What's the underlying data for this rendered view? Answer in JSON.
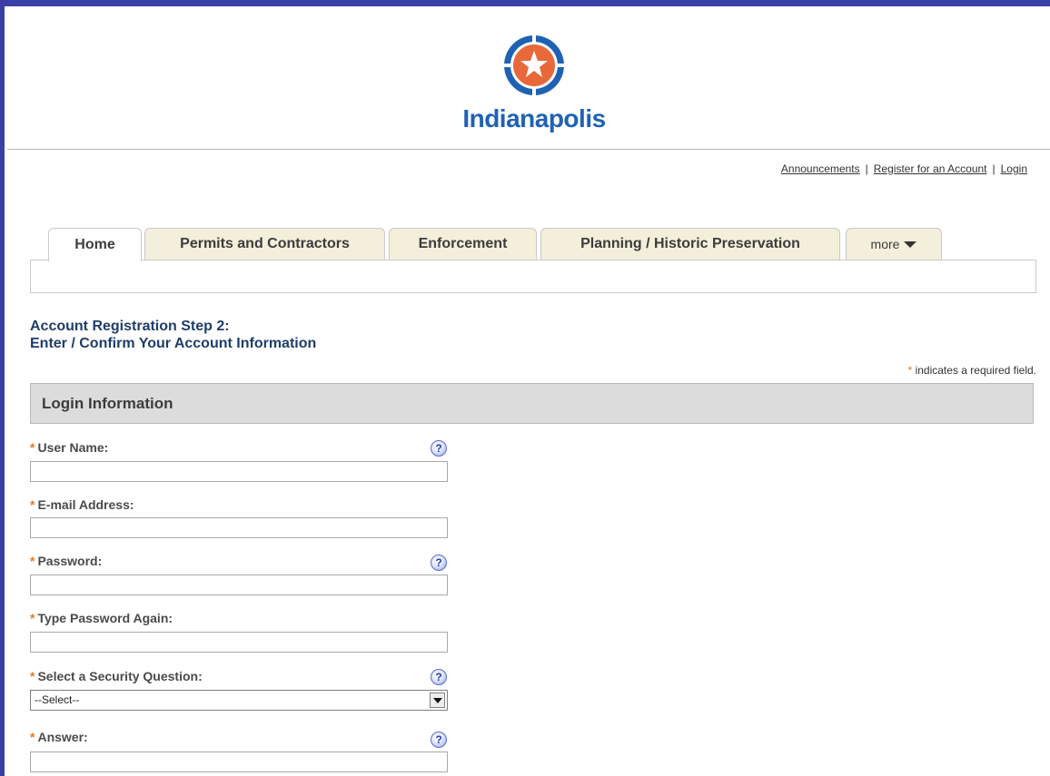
{
  "header": {
    "logo_text": "Indianapolis",
    "brand_color": "#1f62b4",
    "logo_color": "#e8683a"
  },
  "toplinks": {
    "announcements": "Announcements",
    "register": "Register for an Account",
    "login": "Login",
    "separator": "|"
  },
  "tabs": [
    {
      "label": "Home"
    },
    {
      "label": "Permits and Contractors"
    },
    {
      "label": "Enforcement"
    },
    {
      "label": "Planning / Historic Preservation"
    },
    {
      "label": "more"
    }
  ],
  "page": {
    "title_line1": "Account Registration Step 2:",
    "title_line2": "Enter / Confirm Your Account Information",
    "required_star": "*",
    "required_note": "indicates a required field."
  },
  "section": {
    "title": "Login Information"
  },
  "fields": {
    "username": {
      "label": "User Name:",
      "value": ""
    },
    "email": {
      "label": "E-mail Address:",
      "value": ""
    },
    "password": {
      "label": "Password:",
      "value": ""
    },
    "password_again": {
      "label": "Type Password Again:",
      "value": ""
    },
    "security_question": {
      "label": "Select a Security Question:",
      "selected": "--Select--"
    },
    "answer": {
      "label": "Answer:",
      "value": ""
    }
  },
  "icons": {
    "help": "help-icon",
    "help_glyph": "?",
    "more_caret": "chevron-down-icon"
  }
}
